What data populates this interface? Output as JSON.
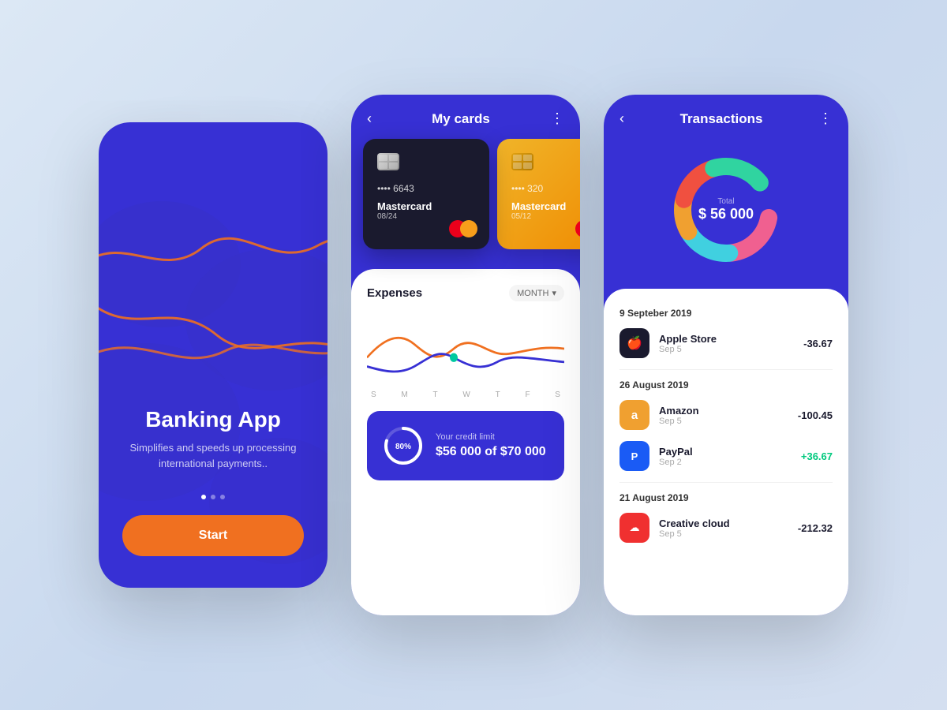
{
  "phone1": {
    "title": "Banking App",
    "subtitle": "Simplifies and speeds up processing international payments..",
    "start_btn": "Start"
  },
  "phone2": {
    "header_title": "My cards",
    "card1": {
      "number": "•••• 6643",
      "brand": "Mastercard",
      "expiry": "08/24"
    },
    "card2": {
      "number": "•••• 320",
      "brand": "Mastercard",
      "expiry": "05/12"
    },
    "expenses_label": "Expenses",
    "month_label": "MONTH",
    "chart_days": [
      "S",
      "M",
      "T",
      "W",
      "T",
      "F",
      "S"
    ],
    "credit": {
      "percent": "80%",
      "label": "Your credit limit",
      "amount": "$56 000 of $70 000"
    }
  },
  "phone3": {
    "header_title": "Transactions",
    "donut": {
      "label": "Total",
      "value": "$ 56 000"
    },
    "sections": [
      {
        "date": "9 Septeber 2019",
        "transactions": [
          {
            "name": "Apple Store",
            "date": "Sep 5",
            "amount": "-36.67",
            "type": "neg",
            "icon": "🍎",
            "icon_style": "icon-black"
          }
        ]
      },
      {
        "date": "26 August 2019",
        "transactions": [
          {
            "name": "Amazon",
            "date": "Sep 5",
            "amount": "-100.45",
            "type": "neg",
            "icon": "a",
            "icon_style": "icon-orange"
          },
          {
            "name": "PayPal",
            "date": "Sep 2",
            "amount": "+36.67",
            "type": "pos",
            "icon": "P",
            "icon_style": "icon-blue"
          }
        ]
      },
      {
        "date": "21 August  2019",
        "transactions": [
          {
            "name": "Creative cloud",
            "date": "Sep 5",
            "amount": "-212.32",
            "type": "neg",
            "icon": "☁",
            "icon_style": "icon-red"
          }
        ]
      }
    ]
  }
}
